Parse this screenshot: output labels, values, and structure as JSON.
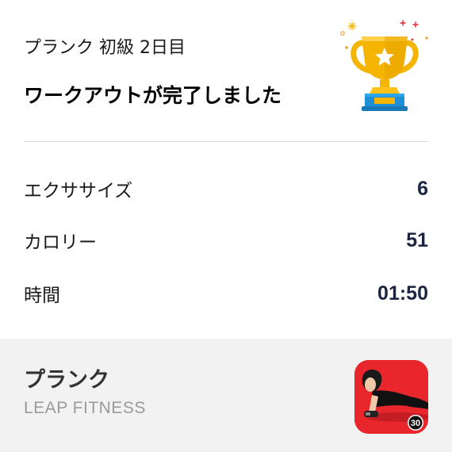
{
  "header": {
    "subtitle": "プランク 初級 2日目",
    "headline": "ワークアウトが完了しました",
    "trophy_icon": "trophy-icon"
  },
  "stats": [
    {
      "label": "エクササイズ",
      "value": "6"
    },
    {
      "label": "カロリー",
      "value": "51"
    },
    {
      "label": "時間",
      "value": "01:50"
    }
  ],
  "app": {
    "name": "プランク",
    "developer": "LEAP FITNESS",
    "icon": "plank-app-icon",
    "icon_badge": "30",
    "icon_color": "#e8262c"
  },
  "colors": {
    "value_text": "#1c2540",
    "banner_bg": "#f2f2f2",
    "divider": "#d9d9d9"
  }
}
